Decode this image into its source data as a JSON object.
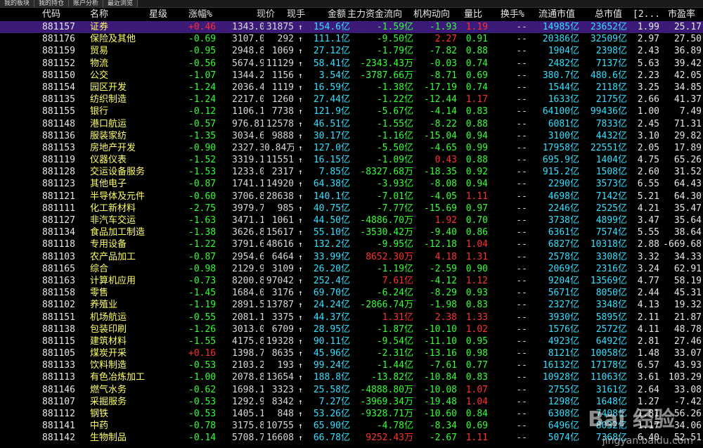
{
  "tabs": [
    "我的板块",
    "我的持仓",
    "账户分析",
    "最近浏览"
  ],
  "headers": {
    "code": "代码",
    "name": "名称",
    "star": "星级",
    "zf": "涨幅%",
    "xj": "现价",
    "xs": "现手",
    "je": "金额",
    "zl": "主力资金流向",
    "jg": "机构动向",
    "lb": "量比",
    "hs": "换手%",
    "lt": "流通市值",
    "zs": "总市值",
    "c12": "[2...",
    "pe": "市盈率"
  },
  "rows": [
    {
      "code": "881157",
      "name": "证券",
      "zf": "+0.46",
      "xj": "1343.050",
      "xs": "31875",
      "je": "154.6亿",
      "zl": "-1.59亿",
      "jg": "-1.93",
      "lb": "1.19",
      "hs": "--",
      "lt": "14985亿",
      "zs": "23652亿",
      "c12": "1.99",
      "pe": "25.17",
      "zfc": "red",
      "zlc": "green",
      "jgc": "green",
      "lbc": "red"
    },
    {
      "code": "881176",
      "name": "保险及其他",
      "zf": "-0.69",
      "xj": "3107.037",
      "xs": "292",
      "je": "111.1亿",
      "zl": "-9.50亿",
      "jg": "2.27",
      "lb": "0.91",
      "hs": "--",
      "lt": "20386亿",
      "zs": "32509亿",
      "c12": "2.97",
      "pe": "27.50",
      "zfc": "green",
      "zlc": "green",
      "jgc": "red",
      "lbc": "green"
    },
    {
      "code": "881159",
      "name": "贸易",
      "zf": "-0.95",
      "xj": "2948.866",
      "xs": "1069",
      "je": "27.12亿",
      "zl": "-1.79亿",
      "jg": "-7.82",
      "lb": "0.88",
      "hs": "--",
      "lt": "1904亿",
      "zs": "2398亿",
      "c12": "2.43",
      "pe": "36.89",
      "zfc": "green",
      "zlc": "green",
      "jgc": "green",
      "lbc": "green"
    },
    {
      "code": "881152",
      "name": "物流",
      "zf": "-0.56",
      "xj": "5674.948",
      "xs": "11129",
      "je": "58.41亿",
      "zl": "-2343.43万",
      "jg": "-0.03",
      "lb": "0.74",
      "hs": "--",
      "lt": "2482亿",
      "zs": "7137亿",
      "c12": "5.63",
      "pe": "39.42",
      "zfc": "green",
      "zlc": "green",
      "jgc": "green",
      "lbc": "green"
    },
    {
      "code": "881150",
      "name": "公交",
      "zf": "-1.07",
      "xj": "1344.283",
      "xs": "1156",
      "je": "3.54亿",
      "zl": "-3787.66万",
      "jg": "-8.71",
      "lb": "0.69",
      "hs": "--",
      "lt": "380.7亿",
      "zs": "480.6亿",
      "c12": "2.23",
      "pe": "42.05",
      "zfc": "green",
      "zlc": "green",
      "jgc": "green",
      "lbc": "green"
    },
    {
      "code": "881154",
      "name": "园区开发",
      "zf": "-1.24",
      "xj": "2036.438",
      "xs": "1119",
      "je": "16.59亿",
      "zl": "-1.38亿",
      "jg": "-17.19",
      "lb": "0.74",
      "hs": "--",
      "lt": "1544亿",
      "zs": "2118亿",
      "c12": "3.25",
      "pe": "34.85",
      "zfc": "green",
      "zlc": "green",
      "jgc": "green",
      "lbc": "green"
    },
    {
      "code": "881135",
      "name": "纺织制造",
      "zf": "-1.24",
      "xj": "2217.084",
      "xs": "1260",
      "je": "27.44亿",
      "zl": "-1.22亿",
      "jg": "-12.44",
      "lb": "1.17",
      "hs": "--",
      "lt": "1633亿",
      "zs": "2175亿",
      "c12": "2.66",
      "pe": "41.37",
      "zfc": "green",
      "zlc": "green",
      "jgc": "green",
      "lbc": "red"
    },
    {
      "code": "881155",
      "name": "银行",
      "zf": "-0.12",
      "xj": "1106.131",
      "xs": "7738",
      "je": "121.9亿",
      "zl": "-5.67亿",
      "jg": "-4.14",
      "lb": "0.83",
      "hs": "--",
      "lt": "64100亿",
      "zs": "99436亿",
      "c12": "1.00",
      "pe": "7.49",
      "zfc": "green",
      "zlc": "green",
      "jgc": "green",
      "lbc": "green"
    },
    {
      "code": "881148",
      "name": "港口航运",
      "zf": "-0.57",
      "xj": "976.815",
      "xs": "12578",
      "je": "46.51亿",
      "zl": "-1.55亿",
      "jg": "-8.22",
      "lb": "0.88",
      "hs": "--",
      "lt": "6081亿",
      "zs": "7833亿",
      "c12": "2.45",
      "pe": "71.31",
      "zfc": "green",
      "zlc": "green",
      "jgc": "green",
      "lbc": "green"
    },
    {
      "code": "881136",
      "name": "服装家纺",
      "zf": "-1.35",
      "xj": "3034.625",
      "xs": "9888",
      "je": "30.17亿",
      "zl": "-1.16亿",
      "jg": "-15.04",
      "lb": "0.94",
      "hs": "--",
      "lt": "3100亿",
      "zs": "4432亿",
      "c12": "3.10",
      "pe": "29.82",
      "zfc": "green",
      "zlc": "green",
      "jgc": "green",
      "lbc": "green"
    },
    {
      "code": "881153",
      "name": "房地产开发",
      "zf": "-0.90",
      "xj": "2327.330",
      "xs": "0.84万",
      "je": "127.0亿",
      "zl": "-5.50亿",
      "jg": "-4.65",
      "lb": "0.99",
      "hs": "--",
      "lt": "17958亿",
      "zs": "22551亿",
      "c12": "2.05",
      "pe": "17.89",
      "zfc": "green",
      "zlc": "green",
      "jgc": "green",
      "lbc": "green"
    },
    {
      "code": "881119",
      "name": "仪器仪表",
      "zf": "-1.52",
      "xj": "3319.147",
      "xs": "11551",
      "je": "16.15亿",
      "zl": "-1.09亿",
      "jg": "0.43",
      "lb": "0.88",
      "hs": "--",
      "lt": "695.9亿",
      "zs": "1404亿",
      "c12": "4.75",
      "pe": "65.26",
      "zfc": "green",
      "zlc": "green",
      "jgc": "red",
      "lbc": "green"
    },
    {
      "code": "881128",
      "name": "交运设备服务",
      "zf": "-1.53",
      "xj": "1233.082",
      "xs": "2317",
      "je": "7.85亿",
      "zl": "-8327.68万",
      "jg": "-18.35",
      "lb": "0.92",
      "hs": "--",
      "lt": "915.2亿",
      "zs": "1508亿",
      "c12": "2.60",
      "pe": "31.52",
      "zfc": "green",
      "zlc": "green",
      "jgc": "green",
      "lbc": "green"
    },
    {
      "code": "881123",
      "name": "其他电子",
      "zf": "-0.87",
      "xj": "1741.130",
      "xs": "14920",
      "je": "64.38亿",
      "zl": "-3.93亿",
      "jg": "-8.08",
      "lb": "0.94",
      "hs": "--",
      "lt": "2290亿",
      "zs": "3573亿",
      "c12": "6.55",
      "pe": "64.43",
      "zfc": "green",
      "zlc": "green",
      "jgc": "green",
      "lbc": "green"
    },
    {
      "code": "881121",
      "name": "半导体及元件",
      "zf": "-0.60",
      "xj": "3706.830",
      "xs": "28638",
      "je": "140.1亿",
      "zl": "-7.01亿",
      "jg": "-4.05",
      "lb": "1.11",
      "hs": "--",
      "lt": "4698亿",
      "zs": "7142亿",
      "c12": "5.21",
      "pe": "64.30",
      "zfc": "green",
      "zlc": "green",
      "jgc": "green",
      "lbc": "red"
    },
    {
      "code": "881111",
      "name": "化工新材料",
      "zf": "-2.75",
      "xj": "3979.790",
      "xs": "985",
      "je": "40.75亿",
      "zl": "-7.77亿",
      "jg": "-15.69",
      "lb": "0.97",
      "hs": "--",
      "lt": "2246亿",
      "zs": "2525亿",
      "c12": "4.21",
      "pe": "35.47",
      "zfc": "green",
      "zlc": "green",
      "jgc": "green",
      "lbc": "green"
    },
    {
      "code": "881127",
      "name": "非汽车交运",
      "zf": "-1.63",
      "xj": "3471.151",
      "xs": "1061",
      "je": "44.50亿",
      "zl": "-4886.70万",
      "jg": "1.92",
      "lb": "0.70",
      "hs": "--",
      "lt": "3738亿",
      "zs": "4899亿",
      "c12": "3.47",
      "pe": "35.64",
      "zfc": "green",
      "zlc": "green",
      "jgc": "red",
      "lbc": "green"
    },
    {
      "code": "881134",
      "name": "食品加工制造",
      "zf": "-1.38",
      "xj": "3626.868",
      "xs": "15617",
      "je": "55.10亿",
      "zl": "-3530.42万",
      "jg": "-9.40",
      "lb": "0.86",
      "hs": "--",
      "lt": "6361亿",
      "zs": "7574亿",
      "c12": "5.55",
      "pe": "38.64",
      "zfc": "green",
      "zlc": "green",
      "jgc": "green",
      "lbc": "green"
    },
    {
      "code": "881118",
      "name": "专用设备",
      "zf": "-1.22",
      "xj": "3791.671",
      "xs": "48616",
      "je": "132.2亿",
      "zl": "-9.95亿",
      "jg": "-12.18",
      "lb": "1.04",
      "hs": "--",
      "lt": "6827亿",
      "zs": "10318亿",
      "c12": "2.88",
      "pe": "-669.68",
      "zfc": "green",
      "zlc": "green",
      "jgc": "green",
      "lbc": "red"
    },
    {
      "code": "881103",
      "name": "农产品加工",
      "zf": "-0.87",
      "xj": "2954.617",
      "xs": "6464",
      "je": "33.99亿",
      "zl": "8652.30万",
      "jg": "4.18",
      "lb": "1.31",
      "hs": "--",
      "lt": "2578亿",
      "zs": "3308亿",
      "c12": "3.32",
      "pe": "34.33",
      "zfc": "green",
      "zlc": "red",
      "jgc": "red",
      "lbc": "red"
    },
    {
      "code": "881165",
      "name": "综合",
      "zf": "-0.98",
      "xj": "2129.967",
      "xs": "3109",
      "je": "26.20亿",
      "zl": "-1.19亿",
      "jg": "-2.59",
      "lb": "0.90",
      "hs": "--",
      "lt": "2069亿",
      "zs": "2316亿",
      "c12": "3.24",
      "pe": "62.91",
      "zfc": "green",
      "zlc": "green",
      "jgc": "green",
      "lbc": "green"
    },
    {
      "code": "881163",
      "name": "计算机应用",
      "zf": "-0.73",
      "xj": "8200.804",
      "xs": "97042",
      "je": "252.4亿",
      "zl": "7.61亿",
      "jg": "-4.12",
      "lb": "1.12",
      "hs": "--",
      "lt": "9204亿",
      "zs": "13569亿",
      "c12": "4.77",
      "pe": "58.19",
      "zfc": "green",
      "zlc": "red",
      "jgc": "green",
      "lbc": "red"
    },
    {
      "code": "881158",
      "name": "零售",
      "zf": "-1.45",
      "xj": "1684.058",
      "xs": "3176",
      "je": "69.70亿",
      "zl": "-6.24亿",
      "jg": "-8.29",
      "lb": "0.93",
      "hs": "--",
      "lt": "5671亿",
      "zs": "8050亿",
      "c12": "2.44",
      "pe": "45.31",
      "zfc": "green",
      "zlc": "green",
      "jgc": "green",
      "lbc": "green"
    },
    {
      "code": "881102",
      "name": "养殖业",
      "zf": "-1.19",
      "xj": "2891.504",
      "xs": "13787",
      "je": "24.24亿",
      "zl": "-2866.74万",
      "jg": "-1.98",
      "lb": "0.83",
      "hs": "--",
      "lt": "2327亿",
      "zs": "3348亿",
      "c12": "4.13",
      "pe": "19.32",
      "zfc": "green",
      "zlc": "green",
      "jgc": "green",
      "lbc": "green"
    },
    {
      "code": "881151",
      "name": "机场航运",
      "zf": "-0.55",
      "xj": "2081.146",
      "xs": "3375",
      "je": "44.37亿",
      "zl": "1.31亿",
      "jg": "2.38",
      "lb": "1.33",
      "hs": "--",
      "lt": "3930亿",
      "zs": "5895亿",
      "c12": "2.11",
      "pe": "21.87",
      "zfc": "green",
      "zlc": "red",
      "jgc": "red",
      "lbc": "red"
    },
    {
      "code": "881138",
      "name": "包装印刷",
      "zf": "-1.26",
      "xj": "3013.088",
      "xs": "6709",
      "je": "28.95亿",
      "zl": "-1.87亿",
      "jg": "-10.10",
      "lb": "1.02",
      "hs": "--",
      "lt": "1576亿",
      "zs": "2572亿",
      "c12": "4.11",
      "pe": "48.78",
      "zfc": "green",
      "zlc": "green",
      "jgc": "green",
      "lbc": "red"
    },
    {
      "code": "881115",
      "name": "建筑材料",
      "zf": "-1.55",
      "xj": "4175.881",
      "xs": "19328",
      "je": "90.11亿",
      "zl": "-9.54亿",
      "jg": "-11.10",
      "lb": "0.95",
      "hs": "--",
      "lt": "4923亿",
      "zs": "6492亿",
      "c12": "2.81",
      "pe": "27.46",
      "zfc": "green",
      "zlc": "green",
      "jgc": "green",
      "lbc": "green"
    },
    {
      "code": "881105",
      "name": "煤炭开采",
      "zf": "+0.16",
      "xj": "1398.713",
      "xs": "8635",
      "je": "45.96亿",
      "zl": "-2.31亿",
      "jg": "-13.16",
      "lb": "0.98",
      "hs": "--",
      "lt": "8121亿",
      "zs": "10058亿",
      "c12": "1.48",
      "pe": "33.07",
      "zfc": "red",
      "zlc": "green",
      "jgc": "green",
      "lbc": "green"
    },
    {
      "code": "881133",
      "name": "饮料制造",
      "zf": "-0.53",
      "xj": "2103.289",
      "xs": "193",
      "je": "99.24亿",
      "zl": "-1.44亿",
      "jg": "-7.61",
      "lb": "0.77",
      "hs": "--",
      "lt": "16132亿",
      "zs": "17178亿",
      "c12": "6.57",
      "pe": "43.93",
      "zfc": "green",
      "zlc": "green",
      "jgc": "green",
      "lbc": "green"
    },
    {
      "code": "881113",
      "name": "有色冶炼加工",
      "zf": "-1.00",
      "xj": "2078.824",
      "xs": "13654",
      "je": "188.8亿",
      "zl": "-13.82亿",
      "jg": "-10.84",
      "lb": "0.83",
      "hs": "--",
      "lt": "10928亿",
      "zs": "11063亿",
      "c12": "3.61",
      "pe": "103.29",
      "zfc": "green",
      "zlc": "green",
      "jgc": "green",
      "lbc": "green"
    },
    {
      "code": "881146",
      "name": "燃气水务",
      "zf": "-0.62",
      "xj": "1698.125",
      "xs": "3323",
      "je": "25.58亿",
      "zl": "-4888.80万",
      "jg": "-10.08",
      "lb": "1.07",
      "hs": "--",
      "lt": "2755亿",
      "zs": "3161亿",
      "c12": "2.64",
      "pe": "33.08",
      "zfc": "green",
      "zlc": "green",
      "jgc": "green",
      "lbc": "red"
    },
    {
      "code": "881107",
      "name": "采掘服务",
      "zf": "-0.53",
      "xj": "1292.993",
      "xs": "8342",
      "je": "7.27亿",
      "zl": "-3969.34万",
      "jg": "-19.48",
      "lb": "1.04",
      "hs": "--",
      "lt": "1298亿",
      "zs": "1648亿",
      "c12": "1.27",
      "pe": "-7.42",
      "zfc": "green",
      "zlc": "green",
      "jgc": "green",
      "lbc": "red"
    },
    {
      "code": "881112",
      "name": "钢铁",
      "zf": "-0.53",
      "xj": "1405.185",
      "xs": "848",
      "je": "53.26亿",
      "zl": "-9328.71万",
      "jg": "-10.60",
      "lb": "0.84",
      "hs": "--",
      "lt": "6308亿",
      "zs": "7408亿",
      "c12": "1.81",
      "pe": "56.26",
      "zfc": "green",
      "zlc": "green",
      "jgc": "green",
      "lbc": "green"
    },
    {
      "code": "881141",
      "name": "中药",
      "zf": "-0.78",
      "xj": "3175.881",
      "xs": "10755",
      "je": "65.90亿",
      "zl": "-4.78亿",
      "jg": "-8.34",
      "lb": "0.69",
      "hs": "--",
      "lt": "6496亿",
      "zs": "8032亿",
      "c12": "1.17",
      "pe": "34.06",
      "zfc": "green",
      "zlc": "green",
      "jgc": "green",
      "lbc": "green"
    },
    {
      "code": "881142",
      "name": "生物制品",
      "zf": "-0.14",
      "xj": "5708.769",
      "xs": "16608",
      "je": "66.78亿",
      "zl": "9252.43万",
      "jg": "-2.67",
      "lb": "1.11",
      "hs": "--",
      "lt": "5074亿",
      "zs": "7368亿",
      "c12": "6.40",
      "pe": "52.51",
      "zfc": "green",
      "zlc": "red",
      "jgc": "green",
      "lbc": "red"
    }
  ],
  "watermark": {
    "main": "Bai 经验",
    "sub": "jingyan.baidu.com"
  }
}
